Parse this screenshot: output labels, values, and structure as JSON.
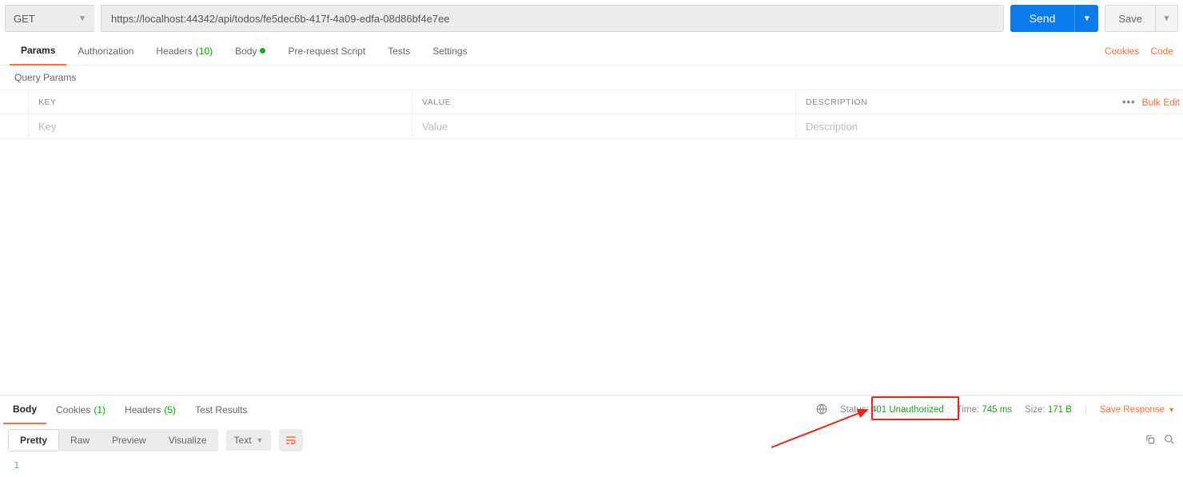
{
  "request": {
    "method": "GET",
    "url": "https://localhost:44342/api/todos/fe5dec6b-417f-4a09-edfa-08d86bf4e7ee",
    "send_label": "Send",
    "save_label": "Save"
  },
  "req_tabs": {
    "params": "Params",
    "authorization": "Authorization",
    "headers": "Headers",
    "headers_count": "(10)",
    "body": "Body",
    "prerequest": "Pre-request Script",
    "tests": "Tests",
    "settings": "Settings",
    "cookies_link": "Cookies",
    "code_link": "Code"
  },
  "query_params_label": "Query Params",
  "ptable": {
    "key_h": "KEY",
    "val_h": "VALUE",
    "desc_h": "DESCRIPTION",
    "key_ph": "Key",
    "val_ph": "Value",
    "desc_ph": "Description",
    "bulk_edit": "Bulk Edit"
  },
  "resp_tabs": {
    "body": "Body",
    "cookies": "Cookies",
    "cookies_count": "(1)",
    "headers": "Headers",
    "headers_count": "(5)",
    "test_results": "Test Results"
  },
  "resp_meta": {
    "status_label": "Status:",
    "status_val": "401 Unauthorized",
    "time_label": "Time:",
    "time_val": "745 ms",
    "size_label": "Size:",
    "size_val": "171 B",
    "save_response": "Save Response"
  },
  "resp_toolbar": {
    "pretty": "Pretty",
    "raw": "Raw",
    "preview": "Preview",
    "visualize": "Visualize",
    "lang": "Text"
  },
  "code_line_num": "1"
}
